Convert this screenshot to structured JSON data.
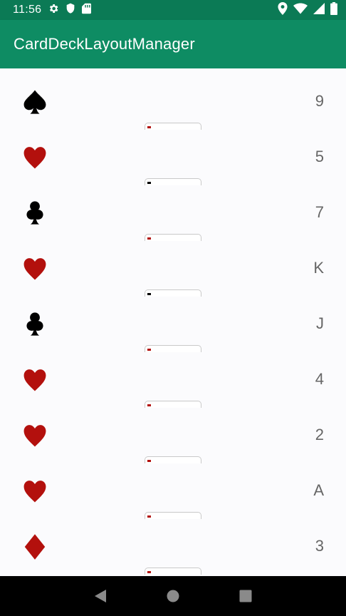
{
  "status_bar": {
    "time": "11:56",
    "left_icons": [
      "gear-icon",
      "shield-icon",
      "sd-card-icon"
    ],
    "right_icons": [
      "location-icon",
      "wifi-icon",
      "signal-icon",
      "battery-icon"
    ]
  },
  "app_bar": {
    "title": "CardDeckLayoutManager"
  },
  "colors": {
    "app_bar": "#0e8c63",
    "status_bar": "#0b7a55",
    "red_suit": "#b3100d",
    "black_suit": "#000000"
  },
  "cards": [
    {
      "suit": "spade",
      "rank": "9"
    },
    {
      "suit": "heart",
      "rank": "5"
    },
    {
      "suit": "club",
      "rank": "7"
    },
    {
      "suit": "heart",
      "rank": "K"
    },
    {
      "suit": "club",
      "rank": "J"
    },
    {
      "suit": "heart",
      "rank": "4"
    },
    {
      "suit": "heart",
      "rank": "2"
    },
    {
      "suit": "heart",
      "rank": "A"
    },
    {
      "suit": "diamond",
      "rank": "3"
    }
  ],
  "nav_bar": {
    "buttons": [
      "back-icon",
      "home-icon",
      "recents-icon"
    ]
  }
}
